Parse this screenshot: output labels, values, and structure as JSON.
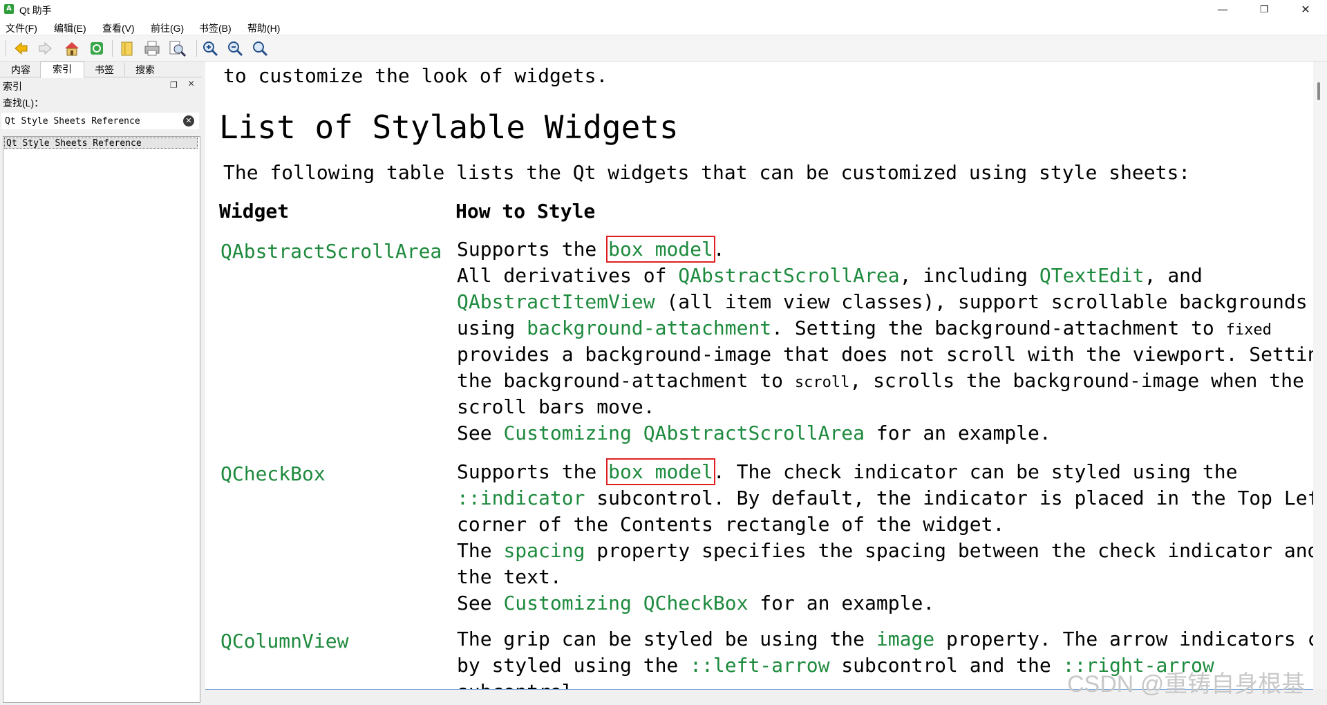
{
  "window": {
    "title": "Qt 助手",
    "app_icon": "A",
    "controls": {
      "minimize": "—",
      "restore": "❐",
      "close": "✕"
    }
  },
  "menu": [
    "文件(F)",
    "编辑(E)",
    "查看(V)",
    "前往(G)",
    "书签(B)",
    "帮助(H)"
  ],
  "toolbar": [
    "back-icon",
    "forward-icon",
    "home-icon",
    "sync-icon",
    "bookmark-icon",
    "print-icon",
    "find-icon",
    "zoom-in-icon",
    "zoom-out-icon",
    "zoom-reset-icon"
  ],
  "sidebar": {
    "tabs": [
      "内容",
      "索引",
      "书签",
      "搜索"
    ],
    "active_tab": "索引",
    "dock_title": "索引",
    "find_label": "查找(L)：",
    "find_value": "Qt Style Sheets Reference",
    "list_items": [
      "Qt Style Sheets Reference"
    ]
  },
  "content": {
    "intro": "to customize the look of widgets.",
    "heading": "List of Stylable Widgets",
    "paragraph": "The following table lists the Qt widgets that can be customized using style sheets:",
    "col_widget": "Widget",
    "col_how": "How to Style",
    "rows": [
      {
        "name": "QAbstractScrollArea",
        "t": {
          "a1": "Supports the ",
          "a2": "box model",
          "a3": ".",
          "b1": "All derivatives of ",
          "b2": "QAbstractScrollArea",
          "b3": ", including ",
          "b4": "QTextEdit",
          "b5": ", and",
          "c1": "QAbstractItemView",
          "c2": " (all item view classes), support scrollable backgrounds",
          "d1": "using ",
          "d2": "background-attachment",
          "d3": ". Setting the background-attachment to ",
          "d4": "fixed",
          "e1": "provides a background-image that does not scroll with the viewport. Setting",
          "f1": "the background-attachment to ",
          "f2": "scroll",
          "f3": ", scrolls the background-image when the",
          "g1": "scroll bars move.",
          "h1": "See ",
          "h2": "Customizing QAbstractScrollArea",
          "h3": " for an example."
        }
      },
      {
        "name": "QCheckBox",
        "t": {
          "a1": "Supports the ",
          "a2": "box model",
          "a3": ". The check indicator can be styled using the",
          "b1": "::indicator",
          "b2": " subcontrol. By default, the indicator is placed in the Top Left",
          "c1": "corner of the Contents rectangle of the widget.",
          "d1": "The ",
          "d2": "spacing",
          "d3": " property specifies the spacing between the check indicator and",
          "e1": "the text.",
          "f1": "See ",
          "f2": "Customizing QCheckBox",
          "f3": " for an example."
        }
      },
      {
        "name": "QColumnView",
        "t": {
          "a1": "The grip can be styled be using the ",
          "a2": "image",
          "a3": " property. The arrow indicators can",
          "b1": "by styled using the ",
          "b2": "::left-arrow",
          "b3": " subcontrol and the ",
          "b4": "::right-arrow",
          "c1": "subcontrol."
        }
      }
    ]
  },
  "watermark": "CSDN @重铸自身根基",
  "colors": {
    "link": "#1d8a3d",
    "highlight_box": "#e02020"
  }
}
